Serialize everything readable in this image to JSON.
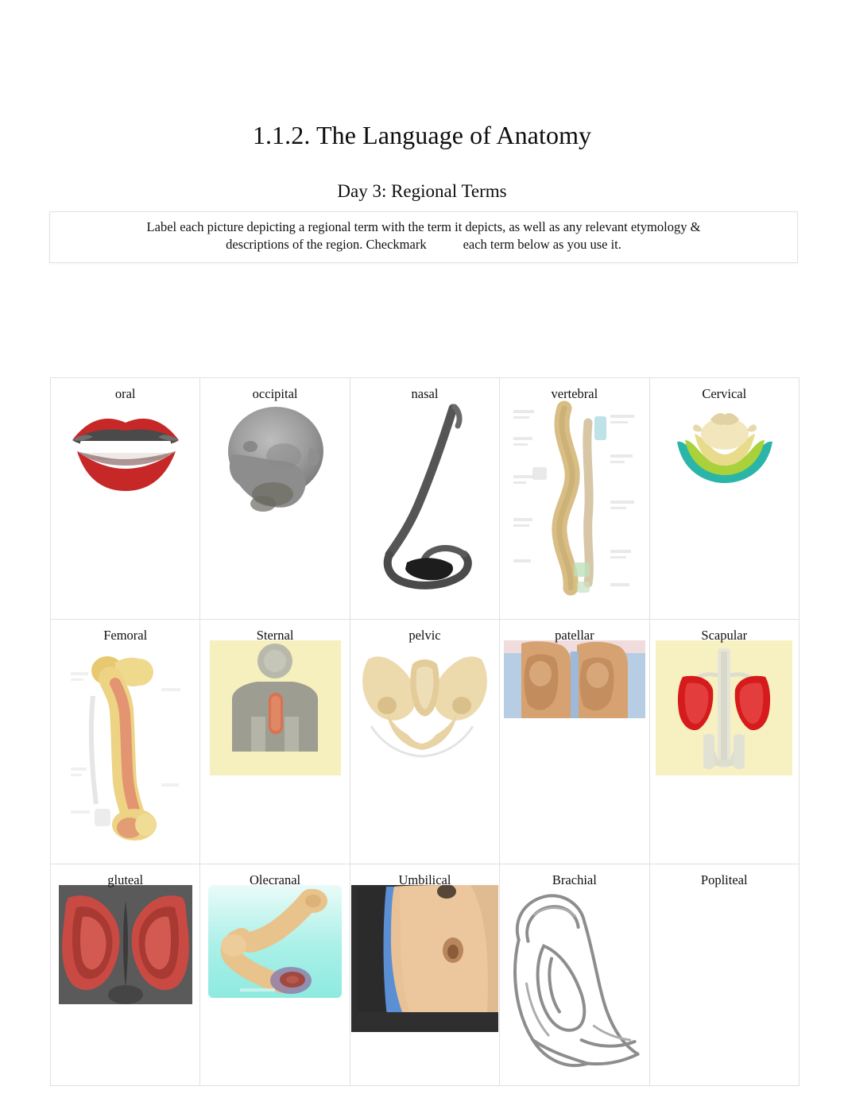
{
  "document": {
    "title": "1.1.2. The Language of Anatomy",
    "subtitle": "Day 3: Regional Terms"
  },
  "instructions": {
    "line1": "Label each picture depicting a regional term with the term it depicts, as well as any relevant etymology &",
    "line2_before": "descriptions of the region. Checkmark",
    "line2_after": "each term below as you use it."
  },
  "table": {
    "columns": 5,
    "rows": [
      [
        {
          "label": "oral",
          "figure": "lips-image"
        },
        {
          "label": "occipital",
          "figure": "skull-back-image"
        },
        {
          "label": "nasal",
          "figure": "nose-outline-image"
        },
        {
          "label": "vertebral",
          "figure": "spine-diagram-image"
        },
        {
          "label": "Cervical",
          "figure": "cervical-vertebra-image"
        }
      ],
      [
        {
          "label": "Femoral",
          "figure": "femur-bone-image"
        },
        {
          "label": "Sternal",
          "figure": "sternum-torso-image"
        },
        {
          "label": "pelvic",
          "figure": "pelvis-bone-image"
        },
        {
          "label": "patellar",
          "figure": "knees-photo-image"
        },
        {
          "label": "Scapular",
          "figure": "scapula-highlight-image"
        }
      ],
      [
        {
          "label": "gluteal",
          "figure": "gluteal-muscles-image"
        },
        {
          "label": "Olecranal",
          "figure": "elbow-olecranon-image"
        },
        {
          "label": "Umbilical",
          "figure": "navel-photo-image"
        },
        {
          "label": "Brachial",
          "figure": "arm-lineart-image"
        },
        {
          "label": "Popliteal",
          "figure": ""
        }
      ]
    ]
  },
  "colors": {
    "page_background": "#ffffff",
    "text": "#101010",
    "table_border": "#e0e0e0",
    "instruction_border": "#e2e2e2",
    "lips_red": "#c62828",
    "skull_grey": "#9a9a9a",
    "bone_tan": "#e8d5a3",
    "cervical_teal": "#2bb5a8",
    "cervical_green": "#a8d13a",
    "sternal_yellow": "#f6efbe",
    "scapular_red": "#d51b1b",
    "gluteal_red": "#c94a42",
    "olecranal_cyan": "#9ff0ea",
    "umbilical_blue": "#5b8fd4",
    "skin_tan": "#e8c197"
  }
}
